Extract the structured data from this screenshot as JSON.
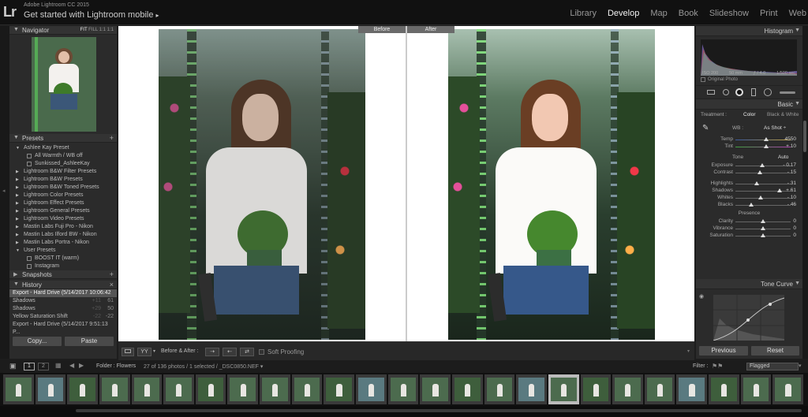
{
  "app": {
    "logo": "Lr",
    "version": "Adobe Lightroom CC 2015",
    "mobile_label": "Get started with Lightroom mobile",
    "mobile_arrow": "▸"
  },
  "modules": [
    "Library",
    "Develop",
    "Map",
    "Book",
    "Slideshow",
    "Print",
    "Web"
  ],
  "active_module": "Develop",
  "navigator": {
    "title": "Navigator",
    "zoom": [
      "FIT",
      "FILL",
      "1:1",
      "1:1"
    ]
  },
  "presets": {
    "title": "Presets",
    "items": [
      {
        "label": "Ashlee Kay Preset",
        "open": true,
        "sub": false
      },
      {
        "label": "All Warmth / WB off",
        "sub": true
      },
      {
        "label": "Sunkissed_AshleeKay",
        "sub": true
      },
      {
        "label": "Lightroom B&W Filter Presets",
        "sub": false
      },
      {
        "label": "Lightroom B&W Presets",
        "sub": false
      },
      {
        "label": "Lightroom B&W Toned Presets",
        "sub": false
      },
      {
        "label": "Lightroom Color Presets",
        "sub": false
      },
      {
        "label": "Lightroom Effect Presets",
        "sub": false
      },
      {
        "label": "Lightroom General Presets",
        "sub": false
      },
      {
        "label": "Lightroom Video Presets",
        "sub": false
      },
      {
        "label": "Mastin Labs Fuji Pro - Nikon",
        "sub": false
      },
      {
        "label": "Mastin Labs Ilford BW - Nikon",
        "sub": false
      },
      {
        "label": "Mastin Labs Portra - Nikon",
        "sub": false
      },
      {
        "label": "User Presets",
        "open": true,
        "sub": false
      },
      {
        "label": "BOOST IT (warm)",
        "sub": true
      },
      {
        "label": "Instagram",
        "sub": true
      }
    ]
  },
  "snapshots": {
    "title": "Snapshots"
  },
  "history": {
    "title": "History",
    "items": [
      {
        "label": "Export - Hard Drive (5/14/2017 10:06:42 ...",
        "sel": true,
        "a": "",
        "v": ""
      },
      {
        "label": "Shadows",
        "a": "+11",
        "v": "61"
      },
      {
        "label": "Shadows",
        "a": "+29",
        "v": "50"
      },
      {
        "label": "Yellow Saturation Shift",
        "a": "-22",
        "v": "-22"
      },
      {
        "label": "Export - Hard Drive (5/14/2017 9:51:13 P...",
        "a": "",
        "v": ""
      }
    ]
  },
  "left_buttons": {
    "copy": "Copy...",
    "paste": "Paste"
  },
  "compare": {
    "before": "Before",
    "after": "After"
  },
  "toolbar": {
    "view": "YY",
    "before_after": "Before & After :",
    "soft_proofing": "Soft Proofing"
  },
  "histogram": {
    "title": "Histogram",
    "iso": "ISO 200",
    "focal": "50 mm",
    "aperture": "ƒ / 4.0",
    "shutter": "1/500 sec",
    "original_photo": "Original Photo"
  },
  "basic": {
    "title": "Basic",
    "treatment_label": "Treatment :",
    "treatment_color": "Color",
    "treatment_bw": "Black & White",
    "wb_label": "WB :",
    "wb_value": "As Shot ÷",
    "temp": {
      "label": "Temp",
      "value": "4550",
      "pos": 0.55
    },
    "tint": {
      "label": "Tint",
      "value": "+ 10",
      "pos": 0.56
    },
    "tone_label": "Tone",
    "auto_label": "Auto",
    "tone": [
      {
        "label": "Exposure",
        "value": "- 0.17",
        "pos": 0.48
      },
      {
        "label": "Contrast",
        "value": "- 15",
        "pos": 0.44
      }
    ],
    "region": [
      {
        "label": "Highlights",
        "value": "- 31",
        "pos": 0.38
      },
      {
        "label": "Shadows",
        "value": "+ 61",
        "pos": 0.8
      },
      {
        "label": "Whites",
        "value": "- 10",
        "pos": 0.46
      },
      {
        "label": "Blacks",
        "value": "- 46",
        "pos": 0.28
      }
    ],
    "presence_label": "Presence",
    "presence": [
      {
        "label": "Clarity",
        "value": "0",
        "pos": 0.5
      },
      {
        "label": "Vibrance",
        "value": "0",
        "pos": 0.5
      },
      {
        "label": "Saturation",
        "value": "0",
        "pos": 0.5
      }
    ]
  },
  "tone_curve": {
    "title": "Tone Curve"
  },
  "right_buttons": {
    "previous": "Previous",
    "reset": "Reset"
  },
  "filmstrip": {
    "folder": "Folder : Flowers",
    "count": "27 of 136 photos / 1 selected / _DSC0850.NEF ▾",
    "filter_label": "Filter :",
    "filter_value": "Flagged",
    "pages": [
      "1",
      "2"
    ],
    "thumb_count": 25,
    "selected_index": 17
  },
  "colors": {
    "accent": "#f2f2f2",
    "panel": "#2b2b2b",
    "background": "#1d1d1d"
  }
}
